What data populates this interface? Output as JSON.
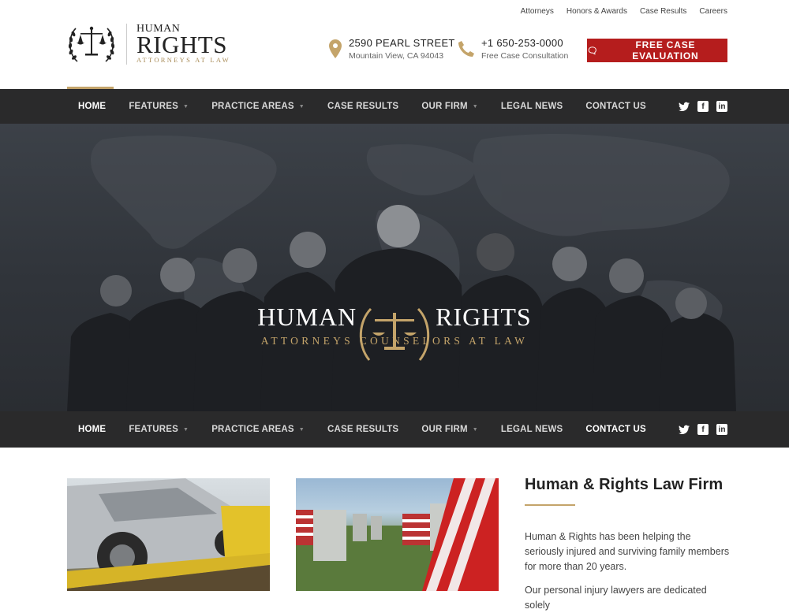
{
  "utility_nav": [
    "Attorneys",
    "Honors & Awards",
    "Case Results",
    "Careers"
  ],
  "logo": {
    "line1": "HUMAN",
    "line2": "RIGHTS",
    "line3": "ATTORNEYS AT LAW"
  },
  "address": {
    "street": "2590 PEARL STREET",
    "city": "Mountain View, CA 94043",
    "icon": "map-pin-icon"
  },
  "phone": {
    "number": "+1 650-253-0000",
    "label": "Free Case Consultation",
    "icon": "phone-icon"
  },
  "cta": {
    "label": "FREE CASE EVALUATION",
    "icon": "chat-icon"
  },
  "nav": {
    "items": [
      {
        "label": "HOME",
        "dropdown": false
      },
      {
        "label": "FEATURES",
        "dropdown": true
      },
      {
        "label": "PRACTICE AREAS",
        "dropdown": true
      },
      {
        "label": "CASE RESULTS",
        "dropdown": false
      },
      {
        "label": "OUR FIRM",
        "dropdown": true
      },
      {
        "label": "LEGAL NEWS",
        "dropdown": false
      },
      {
        "label": "CONTACT US",
        "dropdown": false
      }
    ],
    "social": [
      "twitter-icon",
      "facebook-icon",
      "linkedin-icon"
    ]
  },
  "hero": {
    "title_left": "HUMAN",
    "title_right": "RIGHTS",
    "subtitle": "ATTORNEYS COUNSELORS AT LAW"
  },
  "feature": {
    "heading": "Human & Rights Law Firm",
    "paragraph1": "Human & Rights has been helping the seriously injured and surviving family members for more than 20 years.",
    "paragraph2": "Our personal injury lawyers are dedicated solely"
  },
  "colors": {
    "accent": "#c4a46a",
    "cta": "#b51d1d",
    "nav": "#2a2a2b"
  }
}
